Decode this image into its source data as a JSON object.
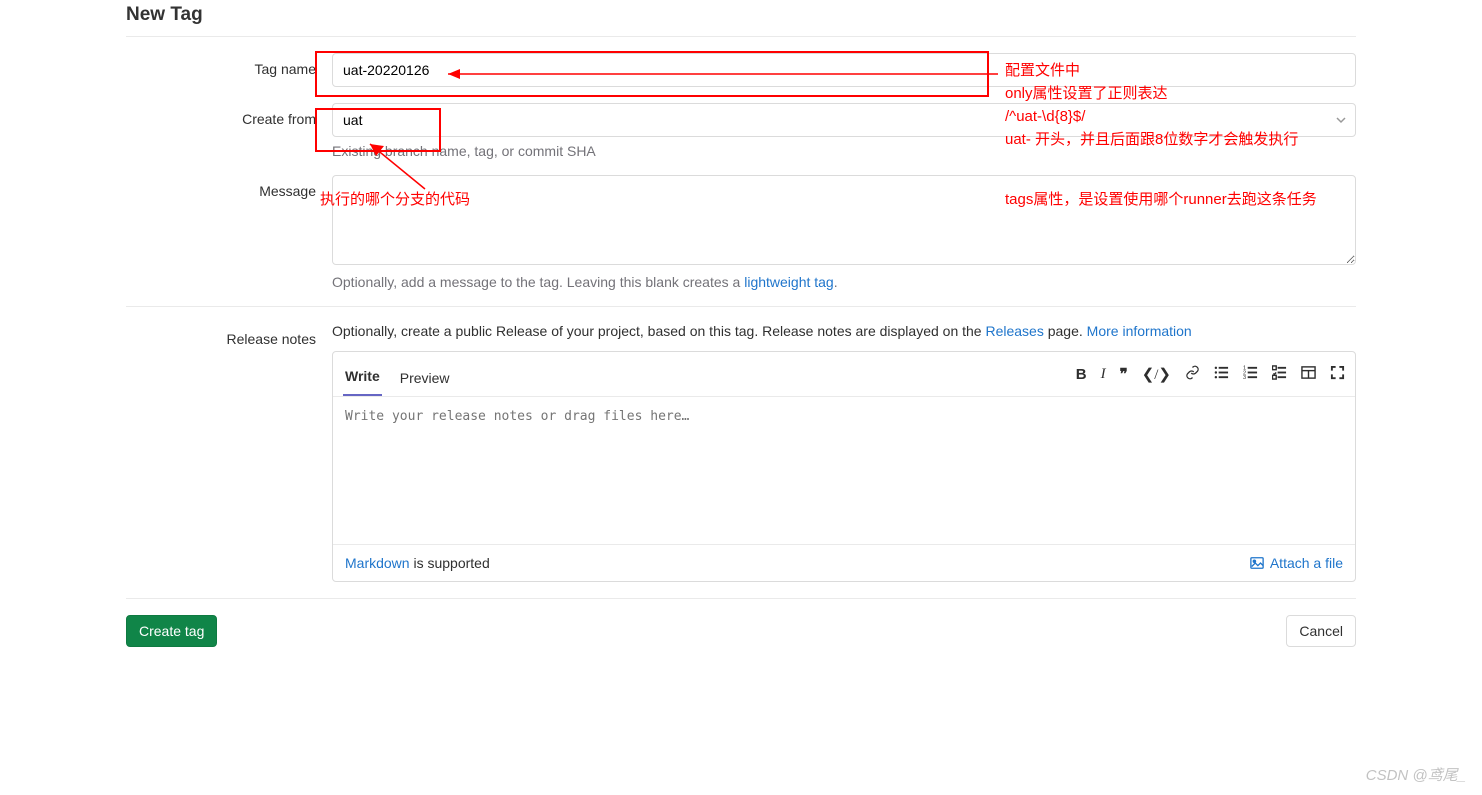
{
  "page": {
    "title": "New Tag"
  },
  "form": {
    "tag_name": {
      "label": "Tag name",
      "value": "uat-20220126"
    },
    "create_from": {
      "label": "Create from",
      "value": "uat",
      "help": "Existing branch name, tag, or commit SHA"
    },
    "message": {
      "label": "Message",
      "value": "",
      "help_pre": "Optionally, add a message to the tag. Leaving this blank creates a ",
      "help_link": "lightweight tag",
      "help_post": "."
    },
    "release": {
      "label": "Release notes",
      "desc_pre": "Optionally, create a public Release of your project, based on this tag. Release notes are displayed on the ",
      "releases_link": "Releases",
      "desc_mid": " page. ",
      "more_info": "More information",
      "tabs": {
        "write": "Write",
        "preview": "Preview"
      },
      "placeholder": "Write your release notes or drag files here…",
      "md_link": "Markdown",
      "md_text": " is supported",
      "attach": "Attach a file"
    }
  },
  "actions": {
    "create": "Create tag",
    "cancel": "Cancel"
  },
  "annotations": {
    "right1": "配置文件中",
    "right2": "only属性设置了正则表达",
    "right3": "/^uat-\\d{8}$/",
    "right4": "uat- 开头，并且后面跟8位数字才会触发执行",
    "right5": "tags属性，是设置使用哪个runner去跑这条任务",
    "left1": "执行的哪个分支的代码"
  },
  "watermark": "CSDN @鸢尾_"
}
